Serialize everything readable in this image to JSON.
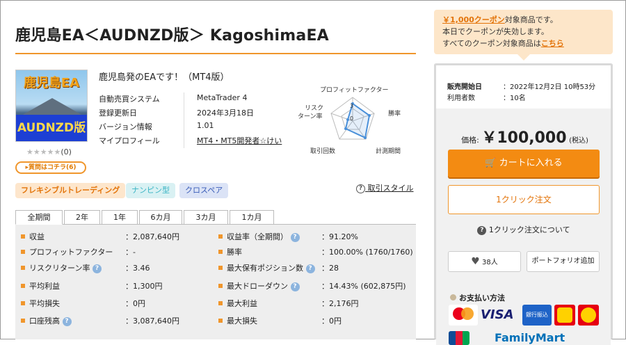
{
  "product": {
    "title": "鹿児島EA＜AUDNZD版＞ KagoshimaEA",
    "thumb_top": "鹿児島EA",
    "thumb_bottom": "AUDNZD版",
    "rating_stars": "★★★★★",
    "rating_count": "(0)",
    "question_button": "▸質問はコチラ(6)",
    "subtitle": "鹿児島発のEAです！（MT4版）",
    "info": [
      {
        "key": "自動売買システム",
        "value": "MetaTrader 4"
      },
      {
        "key": "登録更新日",
        "value": "2024年3月18日"
      },
      {
        "key": "バージョン情報",
        "value": "1.01"
      },
      {
        "key": "マイプロフィール",
        "value": "MT4・MT5開発者☆けい"
      }
    ]
  },
  "radar": {
    "labels": {
      "pf": "プロフィットファクター",
      "win": "勝率",
      "period": "計測期間",
      "trades": "取引回数",
      "risk1": "リスク",
      "risk2": "ターン率"
    },
    "ticks": {
      "outer": "3",
      "inner": "0"
    }
  },
  "tags": [
    "フレキシブルトレーディング",
    "ナンピン型",
    "クロスペア"
  ],
  "trade_style_link": "取引スタイル",
  "tabs": [
    "全期間",
    "2年",
    "1年",
    "6カ月",
    "3カ月",
    "1カ月"
  ],
  "stats_left": [
    {
      "label": "収益",
      "value": "：2,087,640円",
      "help": false
    },
    {
      "label": "プロフィットファクター",
      "value": "：-",
      "help": false
    },
    {
      "label": "リスクリターン率",
      "value": "：3.46",
      "help": true
    },
    {
      "label": "平均利益",
      "value": "：1,300円",
      "help": false
    },
    {
      "label": "平均損失",
      "value": "：0円",
      "help": false
    },
    {
      "label": "口座残高",
      "value": "：3,087,640円",
      "help": true
    }
  ],
  "stats_right": [
    {
      "label": "収益率（全期間）",
      "value": "：91.20%",
      "help": true
    },
    {
      "label": "勝率",
      "value": "：100.00% (1760/1760)",
      "help": false
    },
    {
      "label": "最大保有ポジション数",
      "value": "：28",
      "help": true
    },
    {
      "label": "最大ドローダウン",
      "value": "：14.43% (602,875円)",
      "help": true
    },
    {
      "label": "最大利益",
      "value": "：2,176円",
      "help": false
    },
    {
      "label": "最大損失",
      "value": "：0円",
      "help": false
    }
  ],
  "coupon": {
    "amount": "￥1,000クーポン",
    "line1_rest": "対象商品です。",
    "line2": "本日でクーポンが失効します。",
    "line3": "すべてのクーポン対象商品は",
    "here": "こちら"
  },
  "sale": {
    "start_label": "販売開始日",
    "start_value": "：2022年12月2日 10時53分",
    "users_label": "利用者数",
    "users_value": "：10名",
    "price_label": "価格:",
    "price_value": "￥100,000",
    "price_tax": "(税込)",
    "cart_label": "カートに入れる",
    "oneclick_label": "1クリック注文",
    "oneclick_about": "1クリック注文について",
    "likes": "38人",
    "portfolio_label": "ポートフォリオ追加",
    "payment_title": "お支払い方法",
    "payment_methods": [
      "VISA",
      "銀行振込",
      "FamilyMart"
    ]
  }
}
